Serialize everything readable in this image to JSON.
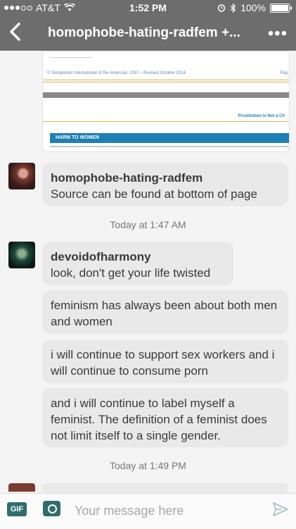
{
  "status_bar": {
    "carrier": "AT&T",
    "time": "1:52 PM",
    "battery": "100%"
  },
  "nav": {
    "title": "homophobe-hating-radfem +...",
    "more": "•••"
  },
  "attachment": {
    "footer_line": "© Soroptimist International of the Americas, 2007 – Revised October 2014.",
    "edge_label": "Pag",
    "section_title": "Prostitution is Not a Ch",
    "heading": "HARM TO WOMEN"
  },
  "messages": [
    {
      "author": "homophobe-hating-radfem",
      "text": "Source can be found at bottom of page"
    },
    {
      "author": "devoidofharmony",
      "text": "look, don't get your life twisted"
    },
    {
      "text": "feminism has always been about both men and women"
    },
    {
      "text": "i will continue to support sex workers and i will continue to consume porn"
    },
    {
      "text": "and i will continue to label myself a feminist. The definition of a feminist does not limit itself to a single gender."
    }
  ],
  "timestamps": [
    "Today at 1:47 AM",
    "Today at 1:49 PM"
  ],
  "composer": {
    "gif_label": "GIF",
    "placeholder": "Your message here"
  }
}
